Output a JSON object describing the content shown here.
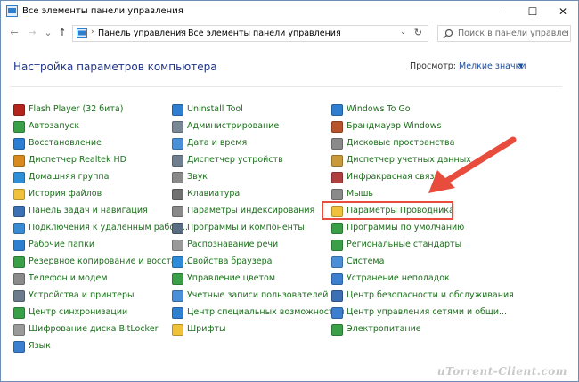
{
  "window": {
    "title": "Все элементы панели управления",
    "minimize": "–",
    "maximize": "☐",
    "close": "✕"
  },
  "nav": {
    "back": "←",
    "forward": "→",
    "recent": "⌄",
    "up": "↑",
    "breadcrumb": [
      "Панель управления",
      "Все элементы панели управления"
    ],
    "crumb_separator": "›",
    "address_dropdown": "⌄",
    "refresh": "↻",
    "search_placeholder": "Поиск в панели управления"
  },
  "header": {
    "title": "Настройка параметров компьютера",
    "view_label": "Просмотр:",
    "view_value": "Мелкие значки",
    "view_caret": "▼"
  },
  "columns": [
    [
      {
        "label": "Flash Player (32 бита)",
        "icon": "flash-icon",
        "color": "#b5241c"
      },
      {
        "label": "Автозапуск",
        "icon": "autoplay-icon",
        "color": "#3aa047"
      },
      {
        "label": "Восстановление",
        "icon": "recovery-icon",
        "color": "#2d7dd2"
      },
      {
        "label": "Диспетчер Realtek HD",
        "icon": "realtek-icon",
        "color": "#d88a1f"
      },
      {
        "label": "Домашняя группа",
        "icon": "homegroup-icon",
        "color": "#2f8fd6"
      },
      {
        "label": "История файлов",
        "icon": "file-history-icon",
        "color": "#f0c23c"
      },
      {
        "label": "Панель задач и навигация",
        "icon": "taskbar-icon",
        "color": "#3c6fb4"
      },
      {
        "label": "Подключения к удаленным рабоч...",
        "icon": "remote-desktop-icon",
        "color": "#3a8ad4"
      },
      {
        "label": "Рабочие папки",
        "icon": "work-folders-icon",
        "color": "#2f7fd0"
      },
      {
        "label": "Резервное копирование и восстан...",
        "icon": "backup-icon",
        "color": "#3aa047"
      },
      {
        "label": "Телефон и модем",
        "icon": "phone-modem-icon",
        "color": "#8a8a8a"
      },
      {
        "label": "Устройства и принтеры",
        "icon": "devices-printers-icon",
        "color": "#6b7b8c"
      },
      {
        "label": "Центр синхронизации",
        "icon": "sync-center-icon",
        "color": "#3aa047"
      },
      {
        "label": "Шифрование диска BitLocker",
        "icon": "bitlocker-icon",
        "color": "#9a9a9a"
      },
      {
        "label": "Язык",
        "icon": "language-icon",
        "color": "#3c7fd0"
      }
    ],
    [
      {
        "label": "Uninstall Tool",
        "icon": "uninstall-tool-icon",
        "color": "#2f7fd0"
      },
      {
        "label": "Администрирование",
        "icon": "admin-tools-icon",
        "color": "#7a8794"
      },
      {
        "label": "Дата и время",
        "icon": "date-time-icon",
        "color": "#4a90d9"
      },
      {
        "label": "Диспетчер устройств",
        "icon": "device-manager-icon",
        "color": "#6f7f90"
      },
      {
        "label": "Звук",
        "icon": "sound-icon",
        "color": "#8a8a8a"
      },
      {
        "label": "Клавиатура",
        "icon": "keyboard-icon",
        "color": "#707070"
      },
      {
        "label": "Параметры индексирования",
        "icon": "indexing-icon",
        "color": "#8a8a8a"
      },
      {
        "label": "Программы и компоненты",
        "icon": "programs-icon",
        "color": "#5a6d82"
      },
      {
        "label": "Распознавание речи",
        "icon": "speech-icon",
        "color": "#9a9a9a"
      },
      {
        "label": "Свойства браузера",
        "icon": "internet-options-icon",
        "color": "#2e8bd8"
      },
      {
        "label": "Управление цветом",
        "icon": "color-management-icon",
        "color": "#3aa047"
      },
      {
        "label": "Учетные записи пользователей",
        "icon": "user-accounts-icon",
        "color": "#4a90d9"
      },
      {
        "label": "Центр специальных возможностей",
        "icon": "ease-of-access-icon",
        "color": "#2f7fd0"
      },
      {
        "label": "Шрифты",
        "icon": "fonts-icon",
        "color": "#f0c23c"
      }
    ],
    [
      {
        "label": "Windows To Go",
        "icon": "windows-to-go-icon",
        "color": "#2f7fd0"
      },
      {
        "label": "Брандмауэр Windows",
        "icon": "firewall-icon",
        "color": "#b7542b"
      },
      {
        "label": "Дисковые пространства",
        "icon": "storage-spaces-icon",
        "color": "#8a8a8a"
      },
      {
        "label": "Диспетчер учетных данных",
        "icon": "credential-manager-icon",
        "color": "#c89a3a"
      },
      {
        "label": "Инфракрасная связь",
        "icon": "infrared-icon",
        "color": "#b04040"
      },
      {
        "label": "Мышь",
        "icon": "mouse-icon",
        "color": "#8a8a8a"
      },
      {
        "label": "Параметры Проводника",
        "icon": "explorer-options-icon",
        "color": "#f0c23c"
      },
      {
        "label": "Программы по умолчанию",
        "icon": "default-programs-icon",
        "color": "#3aa047"
      },
      {
        "label": "Региональные стандарты",
        "icon": "region-icon",
        "color": "#3aa047"
      },
      {
        "label": "Система",
        "icon": "system-icon",
        "color": "#4a90d9"
      },
      {
        "label": "Устранение неполадок",
        "icon": "troubleshooting-icon",
        "color": "#3c7fd0"
      },
      {
        "label": "Центр безопасности и обслуживания",
        "icon": "security-maintenance-icon",
        "color": "#3c6fb4"
      },
      {
        "label": "Центр управления сетями и общи...",
        "icon": "network-center-icon",
        "color": "#3c7fd0"
      },
      {
        "label": "Электропитание",
        "icon": "power-options-icon",
        "color": "#3aa047"
      }
    ]
  ],
  "watermark": "uTorrent-Client.com",
  "colors": {
    "title": "#1e3287",
    "link": "#1a6e1a",
    "accent": "#1e50a2",
    "highlight": "#e84c3d"
  }
}
